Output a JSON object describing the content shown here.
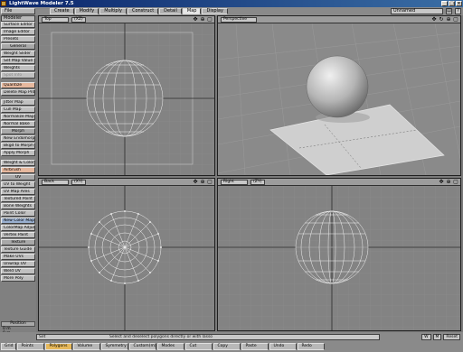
{
  "window": {
    "title": "LightWave Modeler 7.5",
    "controls": [
      "_",
      "□",
      "×"
    ]
  },
  "menu": {
    "file": "File",
    "modeler": "Modeler",
    "tabs": [
      "Create",
      "Modify",
      "Multiply",
      "Construct",
      "Detail",
      "Map",
      "Display"
    ],
    "active_tab": "Map",
    "object_dropdown": "Unnamed"
  },
  "sidebar": [
    {
      "label": "Surface Editor",
      "style": "normal"
    },
    {
      "label": "Image Editor",
      "style": "normal"
    },
    {
      "label": "Presets",
      "style": "normal"
    },
    {
      "label": "General",
      "style": "header"
    },
    {
      "label": "Weight Slider",
      "style": "normal"
    },
    {
      "label": "Set Map Value",
      "style": "normal"
    },
    {
      "label": "Weights",
      "style": "normal"
    },
    {
      "label": "Spot Info",
      "style": "dim"
    },
    {
      "label": "",
      "style": "gap"
    },
    {
      "label": "Quantize",
      "style": "hl"
    },
    {
      "label": "Delete Map Pnts",
      "style": "normal"
    },
    {
      "label": "",
      "style": "gap"
    },
    {
      "label": "Jitter Map",
      "style": "normal"
    },
    {
      "label": "Cull Map",
      "style": "normal"
    },
    {
      "label": "Normalize Map",
      "style": "normal"
    },
    {
      "label": "Normal Bake",
      "style": "normal"
    },
    {
      "label": "Morph",
      "style": "header"
    },
    {
      "label": "New Endomorph",
      "style": "normal"
    },
    {
      "label": "Bkgd to Morph",
      "style": "normal"
    },
    {
      "label": "Apply Morph",
      "style": "normal"
    },
    {
      "label": "",
      "style": "gap"
    },
    {
      "label": "Weight & Color",
      "style": "normal"
    },
    {
      "label": "Airbrush",
      "style": "hl"
    },
    {
      "label": "UV",
      "style": "header"
    },
    {
      "label": "UV to Weight",
      "style": "normal"
    },
    {
      "label": "UV Map Ares",
      "style": "normal"
    },
    {
      "label": "Textured Point",
      "style": "normal"
    },
    {
      "label": "Bone Weights",
      "style": "normal"
    },
    {
      "label": "Point Color",
      "style": "normal"
    },
    {
      "label": "New Color Map",
      "style": "sel"
    },
    {
      "label": "ColorMap Adjust",
      "style": "normal"
    },
    {
      "label": "Vertex Paint",
      "style": "normal"
    },
    {
      "label": "Texture",
      "style": "header"
    },
    {
      "label": "Texture Guide",
      "style": "normal"
    },
    {
      "label": "Make UVs",
      "style": "normal"
    },
    {
      "label": "Unwrap UV",
      "style": "normal"
    },
    {
      "label": "Weld UV",
      "style": "normal"
    },
    {
      "label": "More Poly",
      "style": "normal"
    }
  ],
  "viewports": {
    "top": {
      "label": "Top",
      "mode": "(XZ)"
    },
    "perspective": {
      "label": "Perspective",
      "mode": ""
    },
    "back": {
      "label": "Back",
      "mode": "(XY)"
    },
    "right": {
      "label": "Right",
      "mode": "(ZY)"
    }
  },
  "position_panel": {
    "title": "Position",
    "x": "0 m",
    "y": "0 m",
    "z": "-210 cm"
  },
  "status_bar": {
    "set_label": "Set",
    "message": "Select and deselect polygons directly or with lasso",
    "right_controls": [
      "W",
      "M",
      "Reset"
    ]
  },
  "bottom_modes": [
    "Grid",
    "Points",
    "Polygons",
    "Volume",
    "Symmetry",
    "Custom(m)",
    "Modes",
    "Cut",
    "Copy",
    "Paste",
    "Undo",
    "Redo"
  ],
  "active_mode": "Polygons",
  "grid_value": "1m"
}
